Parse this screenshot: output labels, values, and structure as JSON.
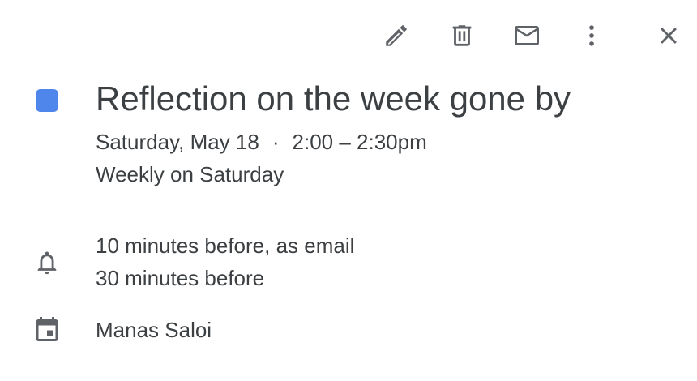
{
  "toolbar": {
    "icons": [
      "pencil-icon",
      "trash-icon",
      "mail-icon",
      "more-vertical-icon",
      "close-icon"
    ]
  },
  "event": {
    "color": "#4f86ec",
    "title": "Reflection on the week gone by",
    "date": "Saturday, May 18",
    "separator": "·",
    "time": "2:00 – 2:30pm",
    "recurrence": "Weekly on Saturday"
  },
  "notifications": {
    "icon": "bell-icon",
    "items": [
      "10 minutes before, as email",
      "30 minutes before"
    ]
  },
  "calendar": {
    "icon": "calendar-icon",
    "owner": "Manas Saloi"
  },
  "colors": {
    "icon": "#5f6368",
    "text": "#3c4043"
  }
}
